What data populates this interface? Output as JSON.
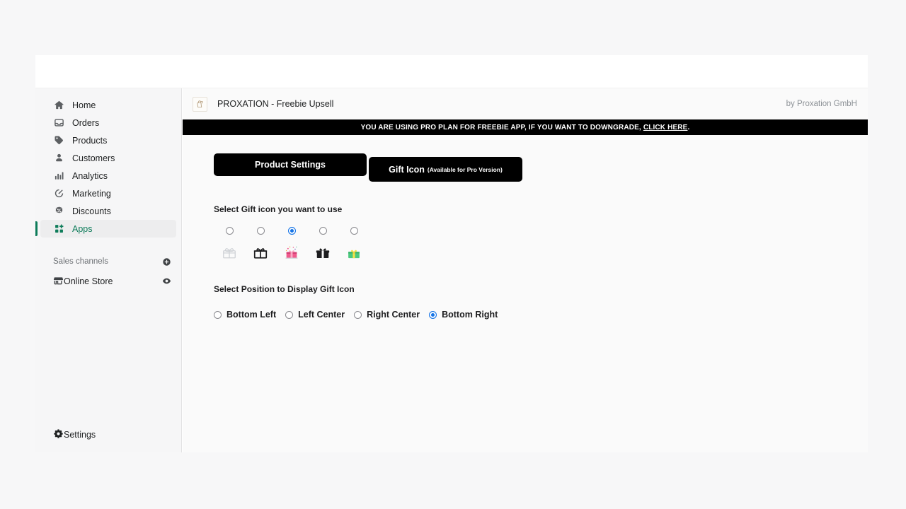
{
  "sidebar": {
    "nav": [
      {
        "label": "Home",
        "icon": "home-icon",
        "active": false
      },
      {
        "label": "Orders",
        "icon": "orders-icon",
        "active": false
      },
      {
        "label": "Products",
        "icon": "products-tag-icon",
        "active": false
      },
      {
        "label": "Customers",
        "icon": "customers-person-icon",
        "active": false
      },
      {
        "label": "Analytics",
        "icon": "analytics-bars-icon",
        "active": false
      },
      {
        "label": "Marketing",
        "icon": "marketing-target-icon",
        "active": false
      },
      {
        "label": "Discounts",
        "icon": "discounts-icon",
        "active": false
      },
      {
        "label": "Apps",
        "icon": "apps-grid-icon",
        "active": true
      }
    ],
    "sales_channels_heading": "Sales channels",
    "add_channel_icon": "plus-circle-icon",
    "channels": [
      {
        "label": "Online Store",
        "icon": "online-store-icon",
        "trailing_icon": "eye-icon"
      }
    ],
    "settings": {
      "label": "Settings",
      "icon": "gear-icon"
    },
    "active_color": "#0e7c5a"
  },
  "app_header": {
    "logo_icon": "shopping-bag-icon",
    "title": "PROXATION - Freebie Upsell",
    "vendor": "by Proxation GmbH"
  },
  "plan_banner": {
    "text": "YOU ARE USING PRO PLAN FOR FREEBIE APP, IF YOU WANT TO DOWNGRADE,",
    "link_text": "CLICK HERE",
    "trailing": ".",
    "background": "#000000"
  },
  "tabs": [
    {
      "label": "Product Settings",
      "sub": "",
      "active": false
    },
    {
      "label": "Gift Icon",
      "sub": "(Available for Pro Version)",
      "active": true
    }
  ],
  "gift_icon_section": {
    "label": "Select Gift icon you want to use",
    "options": [
      {
        "name": "gift-outline-light",
        "selected": false
      },
      {
        "name": "gift-outline-dark",
        "selected": false
      },
      {
        "name": "gift-pink-confetti",
        "selected": true
      },
      {
        "name": "gift-solid-black",
        "selected": false
      },
      {
        "name": "gift-green-yellow",
        "selected": false
      }
    ]
  },
  "position_section": {
    "label": "Select Position to Display Gift Icon",
    "options": [
      {
        "label": "Bottom Left",
        "selected": false
      },
      {
        "label": "Left Center",
        "selected": false
      },
      {
        "label": "Right Center",
        "selected": false
      },
      {
        "label": "Bottom Right",
        "selected": true
      }
    ]
  },
  "colors": {
    "accent_green": "#0e7c5a",
    "radio_blue": "#1473e6",
    "banner_black": "#000000",
    "page_background": "#f7f7f8"
  }
}
